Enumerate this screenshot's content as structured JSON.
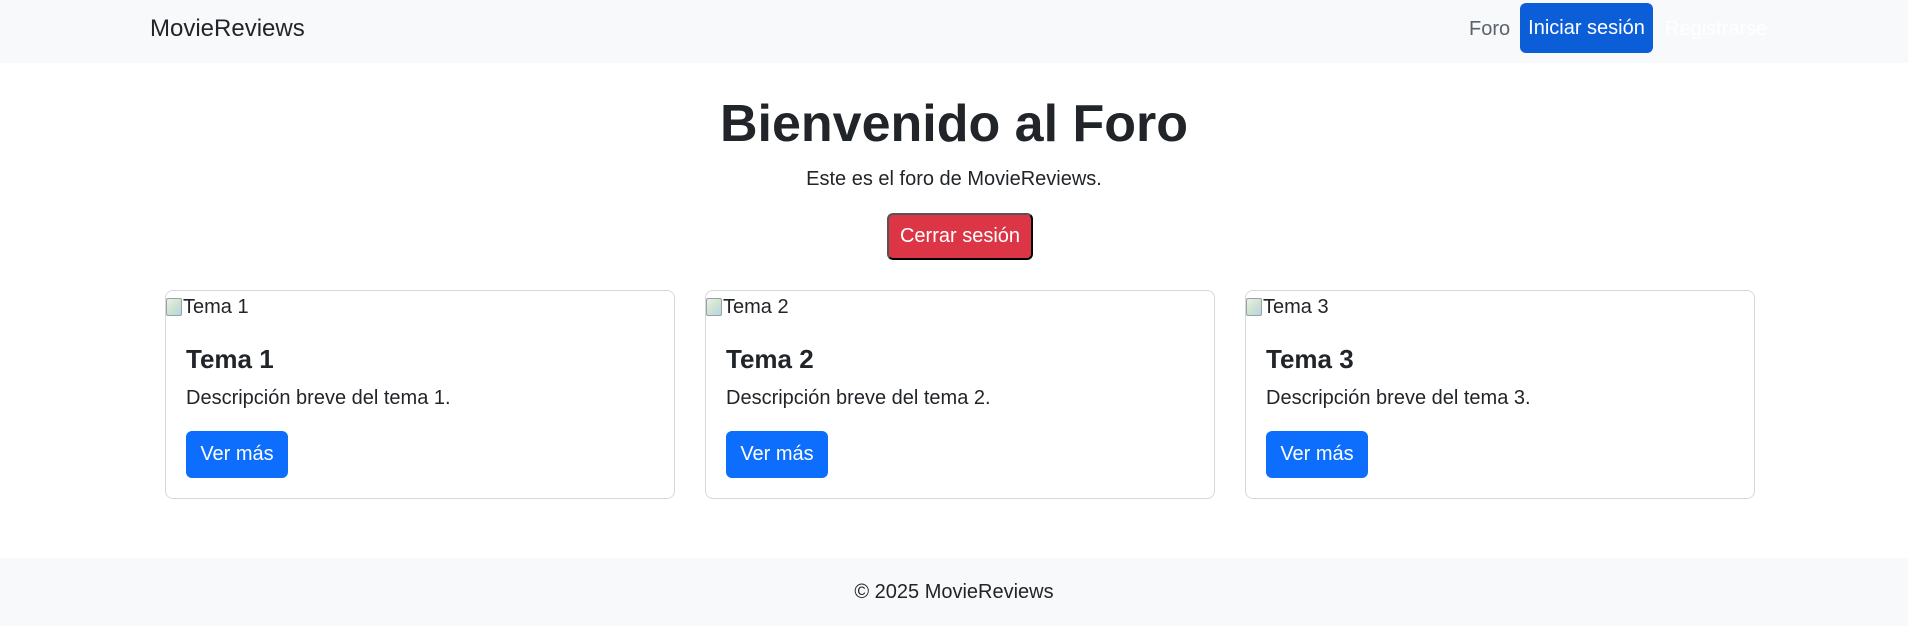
{
  "navbar": {
    "brand": "MovieReviews",
    "links": {
      "foro": "Foro",
      "login": "Iniciar sesión",
      "register": "Registrarse"
    }
  },
  "hero": {
    "title": "Bienvenido al Foro",
    "subtitle": "Este es el foro de MovieReviews.",
    "logout_label": "Cerrar sesión"
  },
  "cards": [
    {
      "image_alt": "Tema 1",
      "title": "Tema 1",
      "text": "Descripción breve del tema 1.",
      "button": "Ver más"
    },
    {
      "image_alt": "Tema 2",
      "title": "Tema 2",
      "text": "Descripción breve del tema 2.",
      "button": "Ver más"
    },
    {
      "image_alt": "Tema 3",
      "title": "Tema 3",
      "text": "Descripción breve del tema 3.",
      "button": "Ver más"
    }
  ],
  "footer": {
    "text": "© 2025 MovieReviews"
  },
  "colors": {
    "primary": "#0d6efd",
    "primary_active": "#0b5ed7",
    "danger": "#dc3545",
    "light_bg": "#f8f9fa"
  },
  "icons": {
    "card_image": "broken-image-icon"
  }
}
